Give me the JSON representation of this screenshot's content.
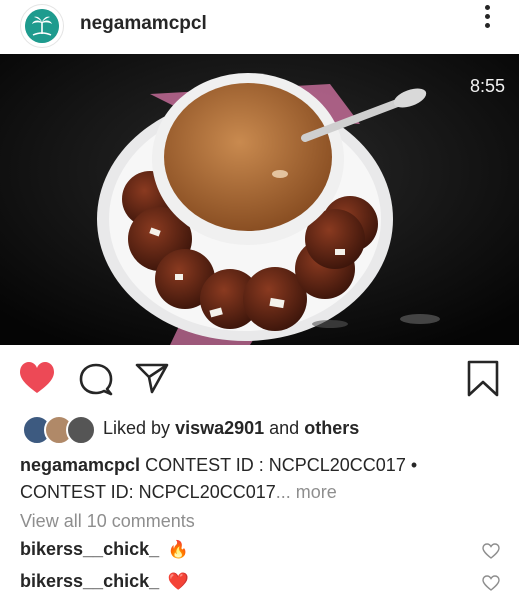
{
  "header": {
    "username": "negamamcpcl",
    "more_icon": "more-vertical-icon"
  },
  "media": {
    "timer": "8:55"
  },
  "actions": {
    "like_icon": "heart-filled-icon",
    "like_color": "#ed4956",
    "comment_icon": "comment-icon",
    "share_icon": "share-icon",
    "save_icon": "bookmark-icon"
  },
  "likes": {
    "prefix": "Liked by",
    "user": "viswa2901",
    "middle": "and",
    "suffix": "others"
  },
  "caption": {
    "username": "negamamcpcl",
    "line1": "CONTEST ID : NCPCL20CC017 •",
    "line2": "CONTEST ID: NCPCL20CC017",
    "more": "... more"
  },
  "comments": {
    "view_all": "View all 10 comments",
    "items": [
      {
        "user": "bikerss__chick_",
        "emoji": "🔥"
      },
      {
        "user": "bikerss__chick_",
        "emoji": "❤️"
      }
    ]
  }
}
